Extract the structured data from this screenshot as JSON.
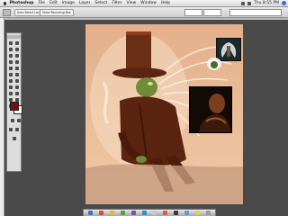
{
  "menubar": {
    "app_name": "Photoshop",
    "items": [
      "File",
      "Edit",
      "Image",
      "Layer",
      "Select",
      "Filter",
      "View",
      "Window",
      "Help"
    ],
    "clock": "Thu 8:55 PM"
  },
  "options_bar": {
    "button_1": "Auto Select Layer",
    "button_2": "Show Bounding Box"
  },
  "colors": {
    "foreground": "#7a0e0e",
    "background": "#ffffff",
    "workspace": "#4a4a4a",
    "canvas_base": "#e6b48e"
  },
  "icons": {
    "apple": "apple-menu-icon",
    "spotlight": "spotlight-icon"
  }
}
